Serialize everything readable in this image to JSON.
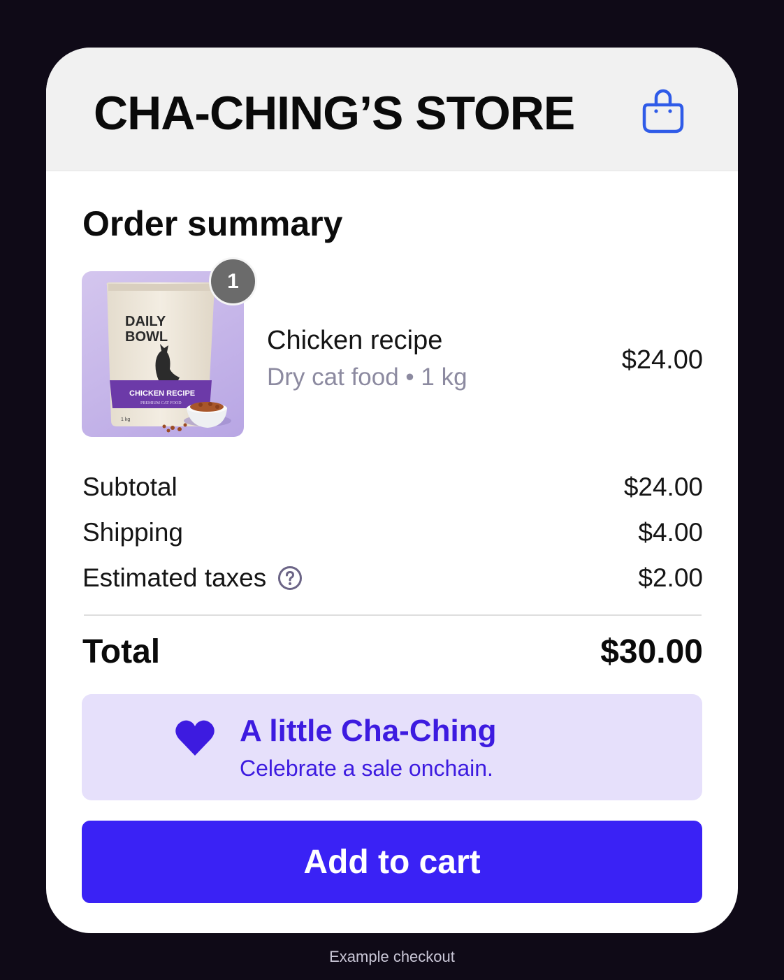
{
  "store": {
    "title": "CHA-CHING’S STORE",
    "bag_icon": "shopping-bag-icon",
    "accent_color": "#2f5be8"
  },
  "order": {
    "title": "Order summary",
    "item": {
      "quantity": "1",
      "name": "Chicken recipe",
      "meta": "Dry cat food • 1 kg",
      "price": "$24.00",
      "package": {
        "brand_line1": "DAILY",
        "brand_line2": "BOWL",
        "band_text": "CHICKEN RECIPE",
        "band_subtext": "PREMIUM CAT FOOD",
        "weight": "1 kg"
      }
    },
    "lines": [
      {
        "label": "Subtotal",
        "value": "$24.00"
      },
      {
        "label": "Shipping",
        "value": "$4.00"
      },
      {
        "label": "Estimated taxes",
        "value": "$2.00"
      }
    ],
    "total_label": "Total",
    "total_value": "$30.00"
  },
  "promo": {
    "icon": "heart-icon",
    "title": "A little Cha-Ching",
    "subtitle": "Celebrate a sale onchain.",
    "background": "#e6e0fb",
    "color": "#3d1be0"
  },
  "cta": {
    "label": "Add to cart",
    "color": "#3a22f5"
  },
  "footer": {
    "caption": "Example checkout"
  }
}
